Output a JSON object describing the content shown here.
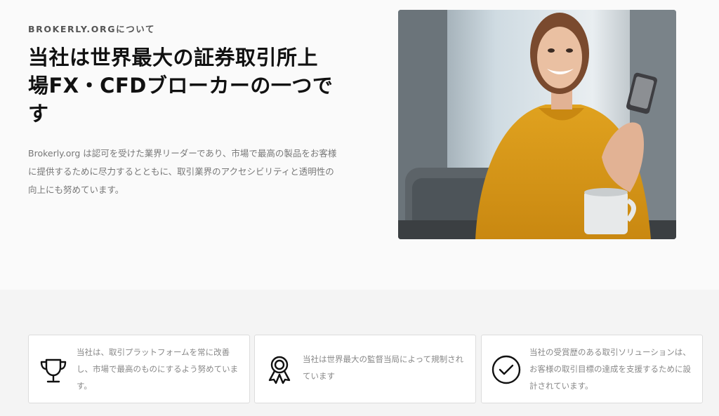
{
  "about": {
    "eyebrow": "BROKERLY.ORGについて",
    "headline": "当社は世界最大の証券取引所上場FX・CFDブローカーの一つです",
    "intro": "Brokerly.org は認可を受けた業界リーダーであり、市場で最高の製品をお客様に提供するために尽力するとともに、取引業界のアクセシビリティと透明性の向上にも努めています。"
  },
  "features": [
    {
      "icon": "trophy-icon",
      "text": "当社は、取引プラットフォームを常に改善し、市場で最高のものにするよう努めています。"
    },
    {
      "icon": "award-ribbon-icon",
      "text": "当社は世界最大の監督当局によって規制されています"
    },
    {
      "icon": "check-circle-icon",
      "text": "当社の受賞歴のある取引ソリューションは、お客様の取引目標の達成を支援するために設計されています。"
    }
  ],
  "colors": {
    "background": "#fafafa",
    "band": "#f4f4f4",
    "text": "#111111",
    "muted": "#888888",
    "card_border": "#dcdcdc"
  }
}
